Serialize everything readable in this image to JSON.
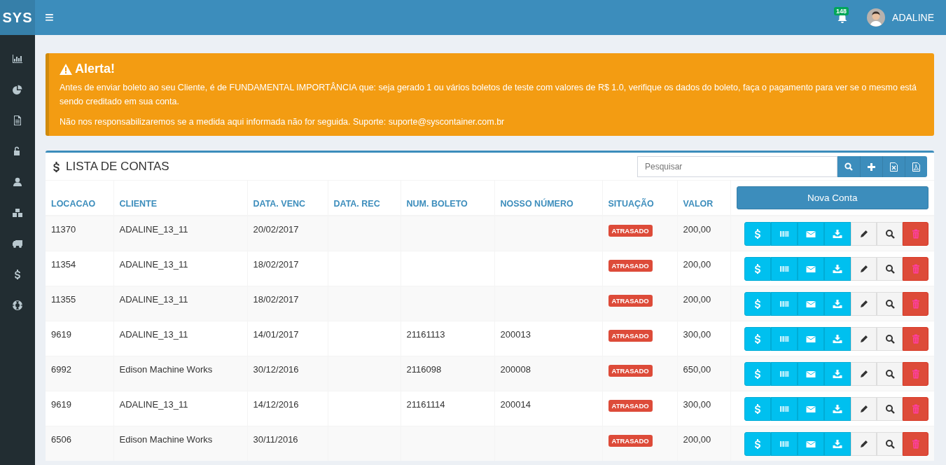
{
  "header": {
    "logo": "SYS",
    "menu_toggle": "≡",
    "notifications": {
      "count": "148"
    },
    "user": {
      "name": "ADALINE"
    }
  },
  "alert": {
    "title": "Alerta!",
    "paragraphs": [
      "Antes de enviar boleto ao seu Cliente, é de FUNDAMENTAL IMPORTÂNCIA que: seja gerado 1 ou vários boletos de teste com valores de R$ 1.0, verifique os dados do boleto, faça o pagamento para ver se o mesmo está sendo creditado em sua conta.",
      "Não nos responsabilizaremos se a medida aqui informada não for seguida. Suporte: suporte@syscontainer.com.br"
    ]
  },
  "panel": {
    "title": "LISTA DE CONTAS",
    "search": {
      "placeholder": "Pesquisar"
    },
    "new_button": "Nova Conta"
  },
  "table": {
    "columns": [
      "LOCACAO",
      "CLIENTE",
      "DATA. VENC",
      "DATA. REC",
      "NUM. BOLETO",
      "NOSSO NÚMERO",
      "SITUAÇÃO",
      "VALOR"
    ],
    "rows": [
      {
        "locacao": "11370",
        "cliente": "ADALINE_13_11",
        "data_venc": "20/02/2017",
        "data_rec": "",
        "num_boleto": "",
        "nosso_numero": "",
        "situacao": "ATRASADO",
        "valor": "200,00"
      },
      {
        "locacao": "11354",
        "cliente": "ADALINE_13_11",
        "data_venc": "18/02/2017",
        "data_rec": "",
        "num_boleto": "",
        "nosso_numero": "",
        "situacao": "ATRASADO",
        "valor": "200,00"
      },
      {
        "locacao": "11355",
        "cliente": "ADALINE_13_11",
        "data_venc": "18/02/2017",
        "data_rec": "",
        "num_boleto": "",
        "nosso_numero": "",
        "situacao": "ATRASADO",
        "valor": "200,00"
      },
      {
        "locacao": "9619",
        "cliente": "ADALINE_13_11",
        "data_venc": "14/01/2017",
        "data_rec": "",
        "num_boleto": "21161113",
        "nosso_numero": "200013",
        "situacao": "ATRASADO",
        "valor": "300,00"
      },
      {
        "locacao": "6992",
        "cliente": "Edison Machine Works",
        "data_venc": "30/12/2016",
        "data_rec": "",
        "num_boleto": "2116098",
        "nosso_numero": "200008",
        "situacao": "ATRASADO",
        "valor": "650,00"
      },
      {
        "locacao": "9619",
        "cliente": "ADALINE_13_11",
        "data_venc": "14/12/2016",
        "data_rec": "",
        "num_boleto": "21161114",
        "nosso_numero": "200014",
        "situacao": "ATRASADO",
        "valor": "300,00"
      },
      {
        "locacao": "6506",
        "cliente": "Edison Machine Works",
        "data_venc": "30/11/2016",
        "data_rec": "",
        "num_boleto": "",
        "nosso_numero": "",
        "situacao": "ATRASADO",
        "valor": "200,00"
      }
    ]
  }
}
